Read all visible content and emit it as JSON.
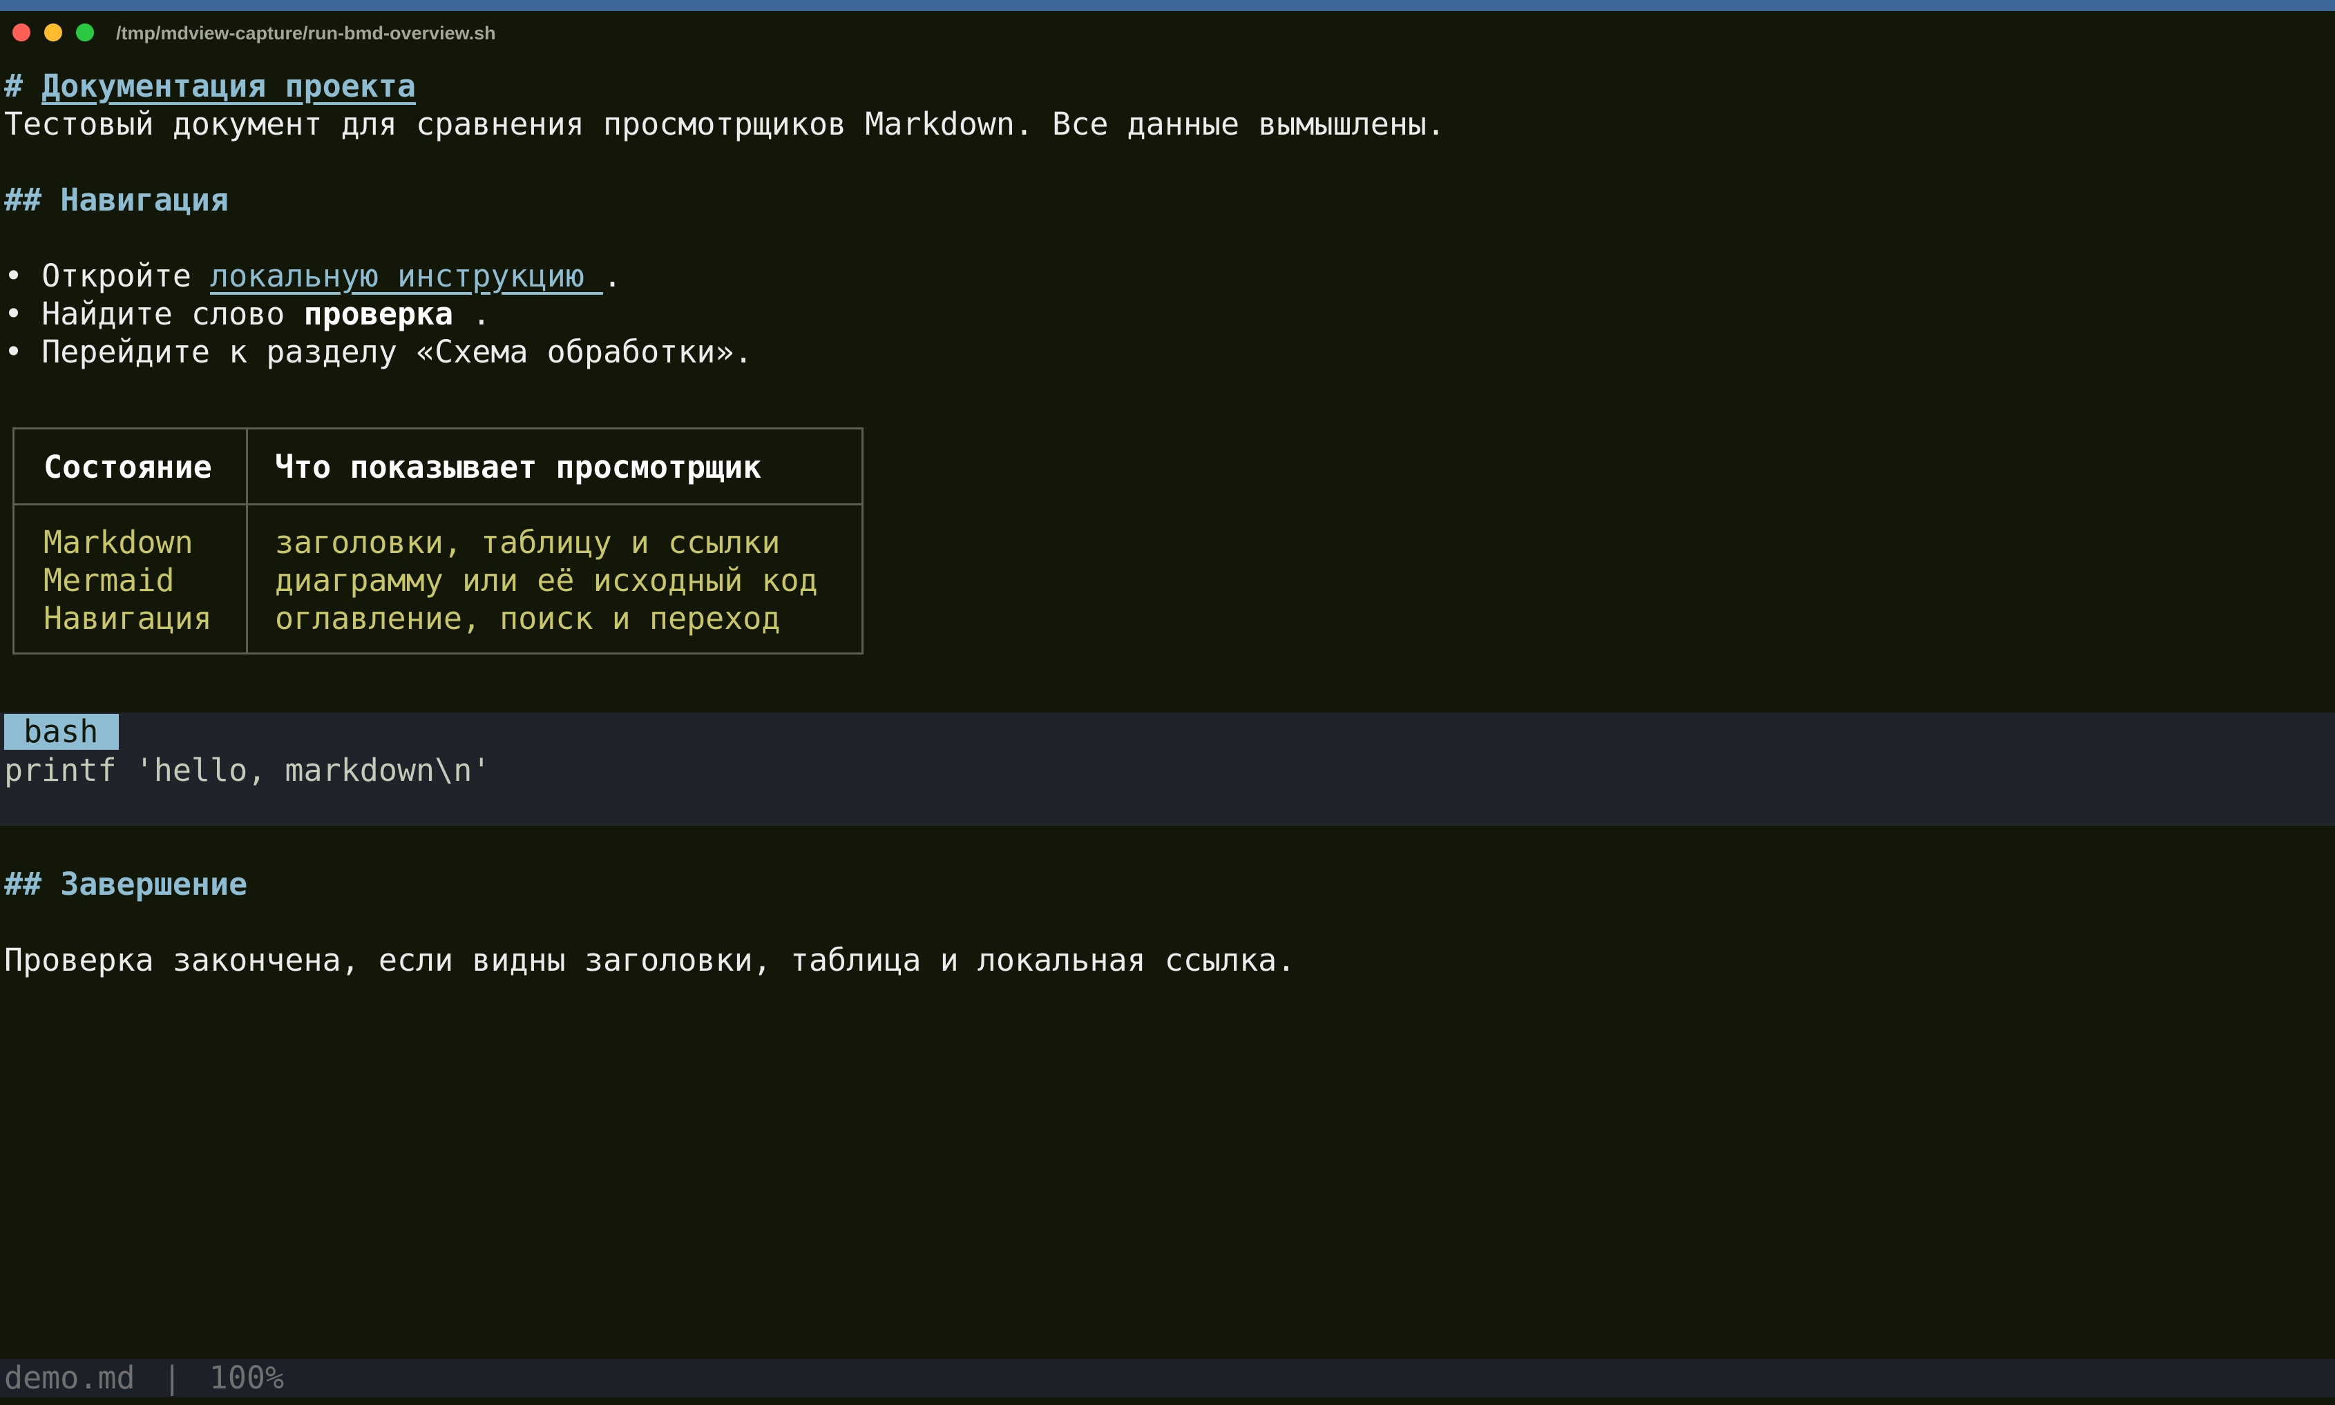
{
  "window": {
    "title": "/tmp/mdview-capture/run-bmd-overview.sh"
  },
  "document": {
    "h1_marker": "#",
    "h1_text": "Документация проекта",
    "intro": "Тестовый документ для сравнения просмотрщиков Markdown. Все данные вымышлены.",
    "h2_marker": "##",
    "nav_heading": "Навигация",
    "bullet_glyph": "•",
    "bullets": [
      {
        "before": "Откройте ",
        "link": "локальную инструкцию ",
        "after": "."
      },
      {
        "before": "Найдите слово ",
        "strong": "проверка ",
        "after": "."
      },
      {
        "text": "Перейдите к разделу «Схема обработки»."
      }
    ],
    "table": {
      "headers": [
        "Состояние",
        "Что показывает просмотрщик"
      ],
      "rows": [
        [
          "Markdown",
          "заголовки, таблицу и ссылки"
        ],
        [
          "Mermaid",
          "диаграмму или её исходный код"
        ],
        [
          "Навигация",
          "оглавление, поиск и переход"
        ]
      ]
    },
    "code": {
      "language": "bash",
      "lines": [
        "printf 'hello, markdown\\n'"
      ]
    },
    "end_heading": "Завершение",
    "final_text": "Проверка закончена, если видны заголовки, таблица и локальная ссылка."
  },
  "status": {
    "filename": "demo.md",
    "separator": "|",
    "zoom": "100%"
  }
}
